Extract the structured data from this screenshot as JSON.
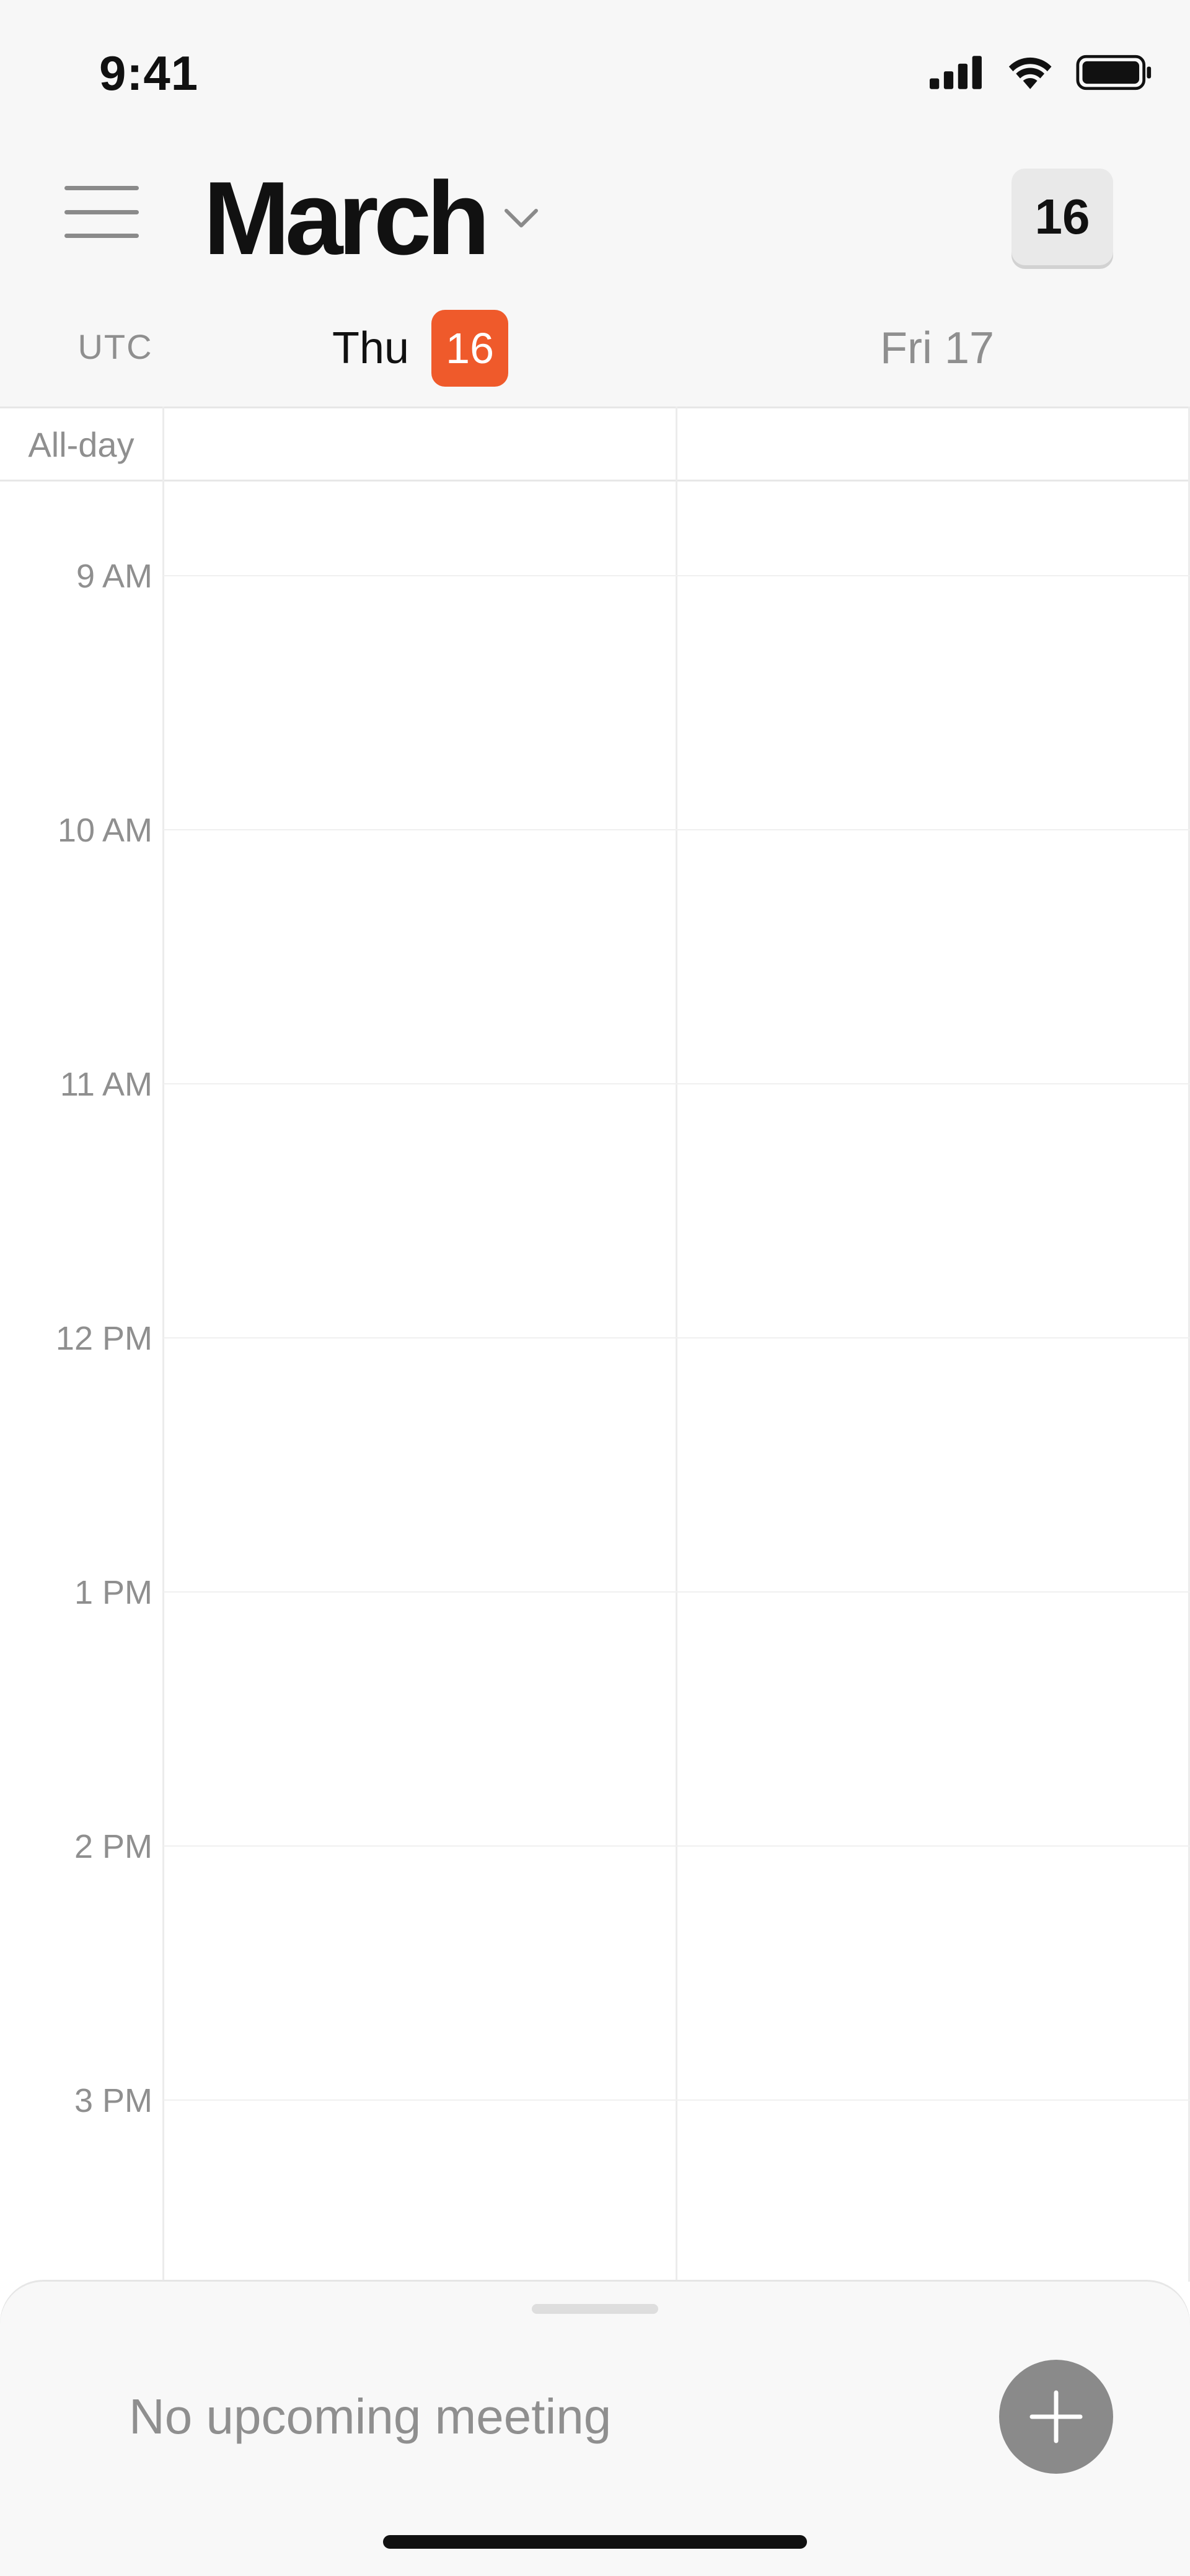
{
  "status_bar": {
    "time": "9:41"
  },
  "header": {
    "month": "March",
    "today_button": "16"
  },
  "day_header": {
    "timezone": "UTC",
    "days": [
      {
        "dow": "Thu",
        "date": "16",
        "selected": true
      },
      {
        "label": "Fri 17",
        "selected": false
      }
    ]
  },
  "grid": {
    "allday_label": "All-day",
    "hours": [
      "9 AM",
      "10 AM",
      "11 AM",
      "12 PM",
      "1 PM",
      "2 PM",
      "3 PM"
    ]
  },
  "bottom_sheet": {
    "message": "No upcoming meeting"
  },
  "colors": {
    "accent": "#ef5a2b",
    "add_button": "#8a8a8a"
  },
  "icons": {
    "menu": "hamburger-icon",
    "month_toggle": "chevron-down-icon",
    "signal": "cellular-signal-icon",
    "wifi": "wifi-icon",
    "battery": "battery-icon",
    "add": "plus-icon"
  }
}
